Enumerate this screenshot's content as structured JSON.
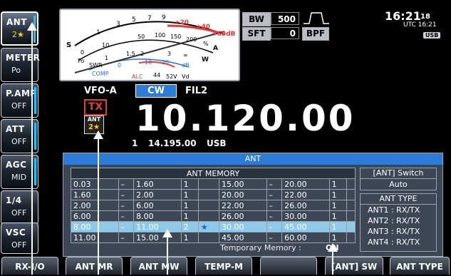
{
  "left_keys": [
    {
      "title": "ANT",
      "sub": "2★",
      "name": "ant-key"
    },
    {
      "title": "METER",
      "sub": "Po",
      "name": "meter-key"
    },
    {
      "title": "P.AMP",
      "sub": "OFF",
      "name": "preamp-key"
    },
    {
      "title": "ATT",
      "sub": "OFF",
      "name": "att-key"
    },
    {
      "title": "AGC",
      "sub": "MID",
      "name": "agc-key"
    },
    {
      "title": "1/4",
      "sub": "OFF",
      "name": "quarter-key"
    },
    {
      "title": "VSC",
      "sub": "OFF",
      "name": "vsc-key"
    }
  ],
  "meter": {
    "top_scale": [
      "1",
      "3",
      "5",
      "7",
      "9",
      "+20",
      "+40",
      "+60dB"
    ],
    "s_label": "S",
    "po_scale": [
      "0",
      "10",
      "50",
      "100",
      "150",
      "200",
      "%"
    ],
    "po_label": "Po",
    "a_label": "A",
    "swr_label": "SWR",
    "swr_scale": [
      "1",
      "1.5",
      "2",
      "3",
      "∞"
    ],
    "w_label": "W",
    "comp_label": "COMP",
    "comp_scale": [
      "0",
      "10",
      "20",
      "dB"
    ],
    "alc_label": "ALC",
    "vd_scale": [
      "44",
      "52V"
    ],
    "vd_label": "Vd"
  },
  "vfo": "VFO-A",
  "mode": "CW",
  "filter": "FIL2",
  "tx": "TX",
  "ant_indicator": {
    "label": "ANT",
    "value": "2★"
  },
  "frequency": "10.120.00",
  "sub_vfo": {
    "num": "1",
    "freq": "14.195.00",
    "mode": "USB"
  },
  "bw": {
    "label": "BW",
    "value": "500"
  },
  "sft": {
    "label": "SFT",
    "value": "0"
  },
  "bpf": "BPF",
  "clock": {
    "time": "16:21",
    "sec": "18",
    "utc": "UTC 16:21",
    "badge": "USB"
  },
  "ant_panel": {
    "title": "ANT",
    "memory_title": "ANT MEMORY",
    "left_rows": [
      {
        "lo": "0.03",
        "hi": "1.60",
        "ant": "1",
        "star": ""
      },
      {
        "lo": "1.60",
        "hi": "2.00",
        "ant": "1",
        "star": ""
      },
      {
        "lo": "2.00",
        "hi": "6.00",
        "ant": "1",
        "star": ""
      },
      {
        "lo": "6.00",
        "hi": "8.00",
        "ant": "1",
        "star": ""
      },
      {
        "lo": "8.00",
        "hi": "11.00",
        "ant": "2",
        "star": "★"
      },
      {
        "lo": "11.00",
        "hi": "15.00",
        "ant": "1",
        "star": ""
      }
    ],
    "right_rows": [
      {
        "lo": "15.00",
        "hi": "20.00",
        "ant": "1"
      },
      {
        "lo": "20.00",
        "hi": "22.00",
        "ant": "1"
      },
      {
        "lo": "22.00",
        "hi": "26.00",
        "ant": "1"
      },
      {
        "lo": "26.00",
        "hi": "30.00",
        "ant": "1"
      },
      {
        "lo": "30.00",
        "hi": "45.00",
        "ant": "1"
      },
      {
        "lo": "45.00",
        "hi": "60.00",
        "ant": "1"
      }
    ],
    "dash": "–",
    "temp_label": "Temporary Memory :",
    "temp_value": "ON",
    "switch_title": "[ANT] Switch",
    "switch_value": "Auto",
    "type_title": "ANT TYPE",
    "types": [
      "ANT1 : RX/TX",
      "ANT2 : RX/TX",
      "ANT3 : RX/TX",
      "ANT4 : RX/TX"
    ]
  },
  "bottom_keys": [
    "RX-I/O",
    "ANT MR",
    "ANT MW",
    "TEMP-M",
    "",
    "[ANT] SW",
    "ANT TYPE"
  ],
  "colors": {
    "accent": "#1ec3ff",
    "panel_header": "#2c7bd6",
    "highlight_row": "#8ec9ea",
    "tx_red": "#e23b3b"
  }
}
